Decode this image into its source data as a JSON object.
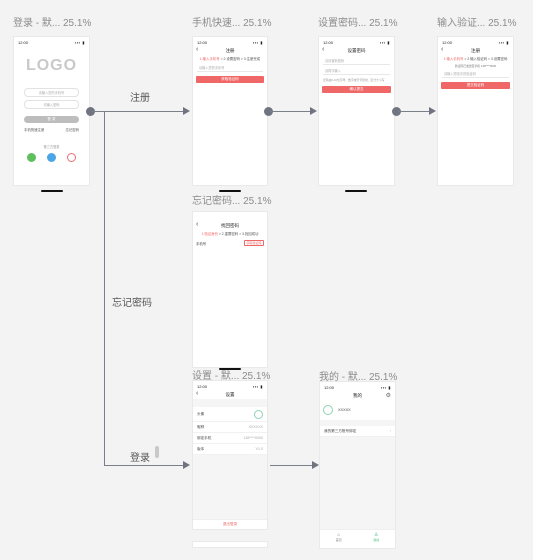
{
  "frame_titles": {
    "login": "登录 - 默... 25.1%",
    "phone_register": "手机快速... 25.1%",
    "set_password": "设置密码... 25.1%",
    "verify_code": "输入验证... 25.1%",
    "forgot_password": "忘记密码... 25.1%",
    "settings": "设置 - 默... 25.1%",
    "mine": "我的 - 默... 25.1%"
  },
  "flow_labels": {
    "register": "注册",
    "forgot": "忘记密码",
    "login": "登录"
  },
  "status": {
    "time": "12:00",
    "signal": "▪▪▪ ▮"
  },
  "login": {
    "logo": "LOGO",
    "phone_placeholder": "请输入您的手机号",
    "password_placeholder": "请输入密码",
    "submit": "登 录",
    "register_link": "手机快速注册",
    "forgot_link": "忘记密码",
    "third_party": "第三方登录"
  },
  "phone_register": {
    "title": "注册",
    "step1": "1.输入手机号",
    "step2": "2.设置密码",
    "step3": "3.注册完成",
    "field": "请输入您的手机号",
    "button": "获取验证码"
  },
  "set_password": {
    "title": "设置密码",
    "field1": "请设置新密码",
    "field2": "请再次输入",
    "hint": "密码由6-16位字母、数字或符号组成，区分大小写",
    "button": "确认提交"
  },
  "verify_code": {
    "title": "注册",
    "step1": "1.输入手机号",
    "step2": "2.输入验证码",
    "step3": "3.设置密码",
    "notice": "验证码已发送至手机 138****0000",
    "field": "请输入短信中的验证码",
    "button": "提交验证码"
  },
  "forgot_password": {
    "title": "找回密码",
    "step1": "1.验证身份",
    "step2": "2.重置密码",
    "step3": "3.找回成功",
    "field": "手机号",
    "code_btn": "获取验证码"
  },
  "settings": {
    "title": "设置",
    "rows": [
      {
        "label": "头像",
        "value": ""
      },
      {
        "label": "昵称",
        "value": "XXXXXX"
      },
      {
        "label": "绑定手机",
        "value": "138****0000"
      },
      {
        "label": "版本",
        "value": "V1.0"
      }
    ],
    "logout": "退出登录"
  },
  "mine": {
    "title": "我的",
    "username": "XXXXX",
    "row": "我的第三方账号绑定",
    "tab_home": "首页",
    "tab_mine": "我的"
  }
}
